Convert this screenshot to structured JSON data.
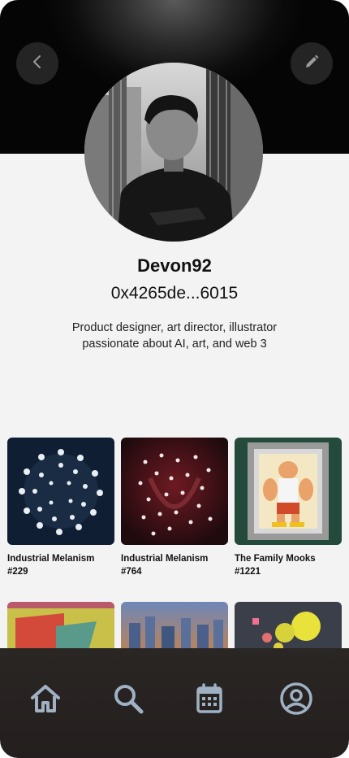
{
  "profile": {
    "username": "Devon92",
    "wallet_address": "0x4265de...6015",
    "bio_line1": "Product designer, art director, illustrator",
    "bio_line2": "passionate about AI, art, and web 3"
  },
  "icons": {
    "back": "chevron-left-icon",
    "edit": "pencil-icon",
    "home": "home-icon",
    "search": "search-icon",
    "calendar": "calendar-icon",
    "profile": "user-circle-icon"
  },
  "collection": [
    {
      "title": "Industrial Melanism",
      "number": "#229"
    },
    {
      "title": "Industrial Melanism",
      "number": "#764"
    },
    {
      "title": "The Family Mooks",
      "number": "#1221"
    }
  ],
  "colors": {
    "background": "#f3f3f3",
    "header": "#0c0c0c",
    "nav_bar": "#262120",
    "nav_icon": "#9fb1c2"
  }
}
